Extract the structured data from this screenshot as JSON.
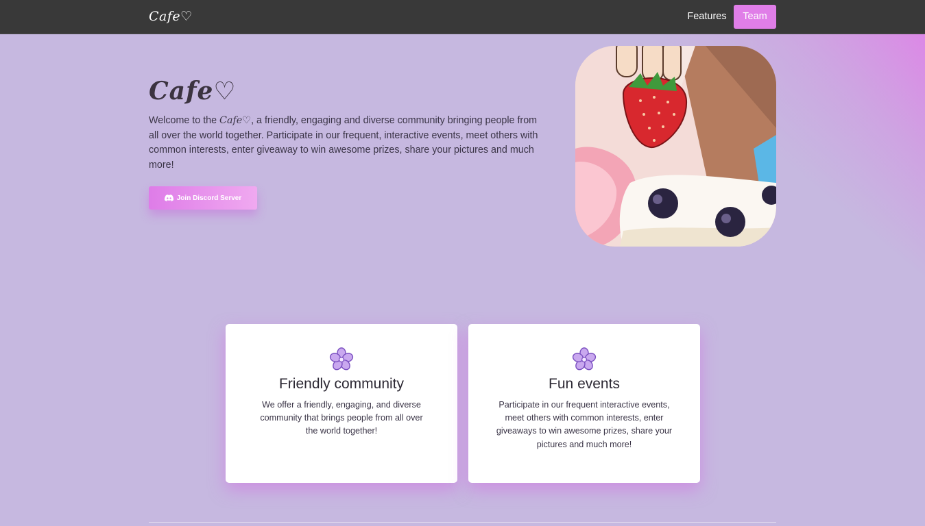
{
  "navbar": {
    "brand": "Cafe♡",
    "links": [
      {
        "label": "Features"
      },
      {
        "label": "Team"
      }
    ]
  },
  "hero": {
    "title": "Cafe♡",
    "description_prefix": "Welcome to the ",
    "description_brand": "Cafe♡",
    "description_suffix": ", a friendly, engaging and diverse community bringing people from all over the world together. Participate in our frequent, interactive events, meet others with common interests, enter giveaway to win awesome prizes, share your pictures and much more!",
    "cta_label": "Join Discord Server",
    "image_icon": "strawberry-dessert-illustration"
  },
  "features": [
    {
      "icon": "sakura-flower-icon",
      "title": "Friendly community",
      "text": "We offer a friendly, engaging, and diverse community that brings people from all over the world together!"
    },
    {
      "icon": "sakura-flower-icon",
      "title": "Fun events",
      "text": "Participate in our frequent interactive events, meet others with common interests, enter giveaways to win awesome prizes, share your pictures and much more!"
    }
  ],
  "colors": {
    "navbar": "#393939",
    "accent": "#e07ee8",
    "background": "#c6b8e0",
    "card": "#ffffff"
  }
}
